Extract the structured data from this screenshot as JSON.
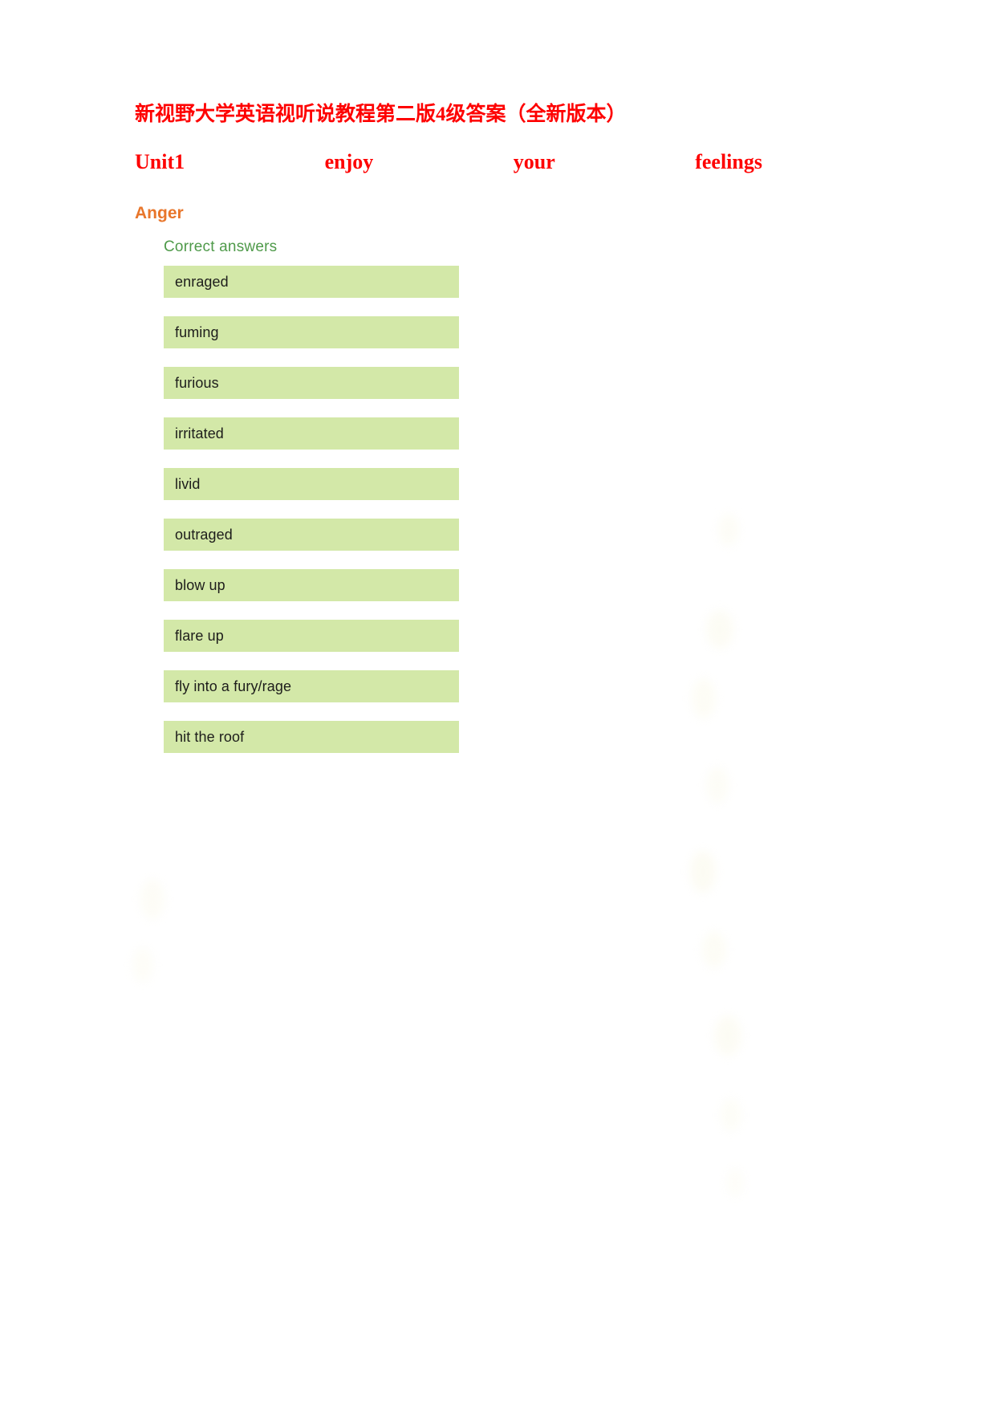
{
  "document": {
    "title": "新视野大学英语视听说教程第二版4级答案（全新版本）",
    "unit_heading": {
      "words": [
        "Unit1",
        "enjoy",
        "your",
        "feelings"
      ]
    },
    "section": {
      "heading": "Anger",
      "answers_label": "Correct answers",
      "answers": [
        "enraged",
        "fuming",
        "furious",
        "irritated",
        "livid",
        "outraged",
        "blow up",
        "flare up",
        "fly into a fury/rage",
        "hit the roof"
      ]
    }
  },
  "colors": {
    "title_red": "#fe0000",
    "heading_orange": "#e8762b",
    "answers_label_green": "#4f9a4a",
    "answer_box_green": "#d3e8a8",
    "answer_text": "#1d1d1b",
    "page_background": "#ffffff"
  }
}
